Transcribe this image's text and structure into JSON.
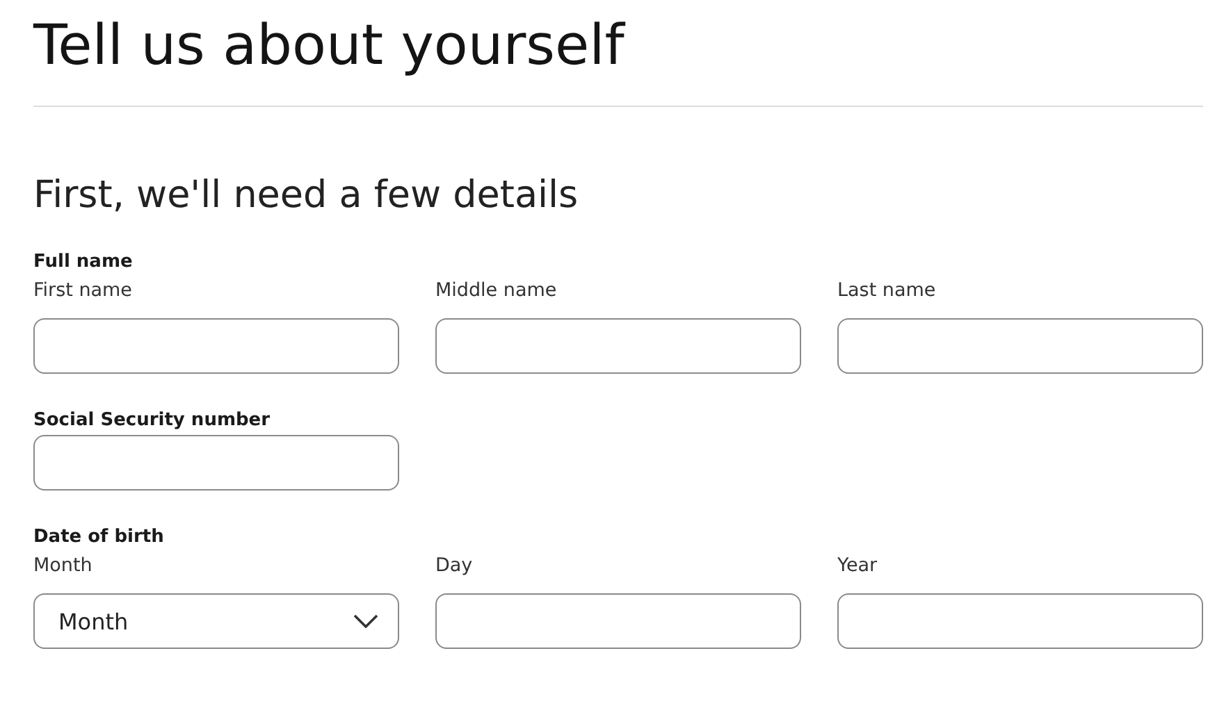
{
  "title": "Tell us about yourself",
  "subtitle": "First, we'll need a few details",
  "sections": [
    {
      "label": "Full name",
      "fields": [
        {
          "kind": "text",
          "label": "First name"
        },
        {
          "kind": "text",
          "label": "Middle name"
        },
        {
          "kind": "text",
          "label": "Last name"
        }
      ]
    },
    {
      "label": "Social Security number",
      "fields": [
        {
          "kind": "text"
        }
      ]
    },
    {
      "label": "Date of birth",
      "fields": [
        {
          "kind": "select",
          "label": "Month",
          "value": "Month"
        },
        {
          "kind": "text",
          "label": "Day"
        },
        {
          "kind": "text",
          "label": "Year"
        }
      ]
    }
  ]
}
